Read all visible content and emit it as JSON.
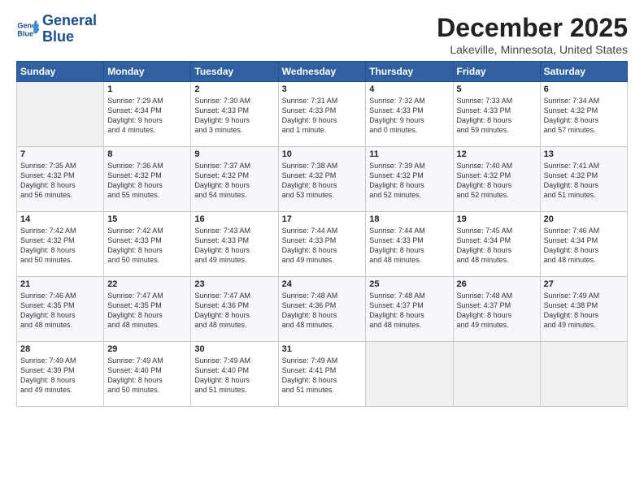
{
  "logo": {
    "line1": "General",
    "line2": "Blue"
  },
  "title": "December 2025",
  "location": "Lakeville, Minnesota, United States",
  "days_of_week": [
    "Sunday",
    "Monday",
    "Tuesday",
    "Wednesday",
    "Thursday",
    "Friday",
    "Saturday"
  ],
  "weeks": [
    [
      {
        "day": "",
        "info": ""
      },
      {
        "day": "1",
        "info": "Sunrise: 7:29 AM\nSunset: 4:34 PM\nDaylight: 9 hours\nand 4 minutes."
      },
      {
        "day": "2",
        "info": "Sunrise: 7:30 AM\nSunset: 4:33 PM\nDaylight: 9 hours\nand 3 minutes."
      },
      {
        "day": "3",
        "info": "Sunrise: 7:31 AM\nSunset: 4:33 PM\nDaylight: 9 hours\nand 1 minute."
      },
      {
        "day": "4",
        "info": "Sunrise: 7:32 AM\nSunset: 4:33 PM\nDaylight: 9 hours\nand 0 minutes."
      },
      {
        "day": "5",
        "info": "Sunrise: 7:33 AM\nSunset: 4:33 PM\nDaylight: 8 hours\nand 59 minutes."
      },
      {
        "day": "6",
        "info": "Sunrise: 7:34 AM\nSunset: 4:32 PM\nDaylight: 8 hours\nand 57 minutes."
      }
    ],
    [
      {
        "day": "7",
        "info": "Sunrise: 7:35 AM\nSunset: 4:32 PM\nDaylight: 8 hours\nand 56 minutes."
      },
      {
        "day": "8",
        "info": "Sunrise: 7:36 AM\nSunset: 4:32 PM\nDaylight: 8 hours\nand 55 minutes."
      },
      {
        "day": "9",
        "info": "Sunrise: 7:37 AM\nSunset: 4:32 PM\nDaylight: 8 hours\nand 54 minutes."
      },
      {
        "day": "10",
        "info": "Sunrise: 7:38 AM\nSunset: 4:32 PM\nDaylight: 8 hours\nand 53 minutes."
      },
      {
        "day": "11",
        "info": "Sunrise: 7:39 AM\nSunset: 4:32 PM\nDaylight: 8 hours\nand 52 minutes."
      },
      {
        "day": "12",
        "info": "Sunrise: 7:40 AM\nSunset: 4:32 PM\nDaylight: 8 hours\nand 52 minutes."
      },
      {
        "day": "13",
        "info": "Sunrise: 7:41 AM\nSunset: 4:32 PM\nDaylight: 8 hours\nand 51 minutes."
      }
    ],
    [
      {
        "day": "14",
        "info": "Sunrise: 7:42 AM\nSunset: 4:32 PM\nDaylight: 8 hours\nand 50 minutes."
      },
      {
        "day": "15",
        "info": "Sunrise: 7:42 AM\nSunset: 4:33 PM\nDaylight: 8 hours\nand 50 minutes."
      },
      {
        "day": "16",
        "info": "Sunrise: 7:43 AM\nSunset: 4:33 PM\nDaylight: 8 hours\nand 49 minutes."
      },
      {
        "day": "17",
        "info": "Sunrise: 7:44 AM\nSunset: 4:33 PM\nDaylight: 8 hours\nand 49 minutes."
      },
      {
        "day": "18",
        "info": "Sunrise: 7:44 AM\nSunset: 4:33 PM\nDaylight: 8 hours\nand 48 minutes."
      },
      {
        "day": "19",
        "info": "Sunrise: 7:45 AM\nSunset: 4:34 PM\nDaylight: 8 hours\nand 48 minutes."
      },
      {
        "day": "20",
        "info": "Sunrise: 7:46 AM\nSunset: 4:34 PM\nDaylight: 8 hours\nand 48 minutes."
      }
    ],
    [
      {
        "day": "21",
        "info": "Sunrise: 7:46 AM\nSunset: 4:35 PM\nDaylight: 8 hours\nand 48 minutes."
      },
      {
        "day": "22",
        "info": "Sunrise: 7:47 AM\nSunset: 4:35 PM\nDaylight: 8 hours\nand 48 minutes."
      },
      {
        "day": "23",
        "info": "Sunrise: 7:47 AM\nSunset: 4:36 PM\nDaylight: 8 hours\nand 48 minutes."
      },
      {
        "day": "24",
        "info": "Sunrise: 7:48 AM\nSunset: 4:36 PM\nDaylight: 8 hours\nand 48 minutes."
      },
      {
        "day": "25",
        "info": "Sunrise: 7:48 AM\nSunset: 4:37 PM\nDaylight: 8 hours\nand 48 minutes."
      },
      {
        "day": "26",
        "info": "Sunrise: 7:48 AM\nSunset: 4:37 PM\nDaylight: 8 hours\nand 49 minutes."
      },
      {
        "day": "27",
        "info": "Sunrise: 7:49 AM\nSunset: 4:38 PM\nDaylight: 8 hours\nand 49 minutes."
      }
    ],
    [
      {
        "day": "28",
        "info": "Sunrise: 7:49 AM\nSunset: 4:39 PM\nDaylight: 8 hours\nand 49 minutes."
      },
      {
        "day": "29",
        "info": "Sunrise: 7:49 AM\nSunset: 4:40 PM\nDaylight: 8 hours\nand 50 minutes."
      },
      {
        "day": "30",
        "info": "Sunrise: 7:49 AM\nSunset: 4:40 PM\nDaylight: 8 hours\nand 51 minutes."
      },
      {
        "day": "31",
        "info": "Sunrise: 7:49 AM\nSunset: 4:41 PM\nDaylight: 8 hours\nand 51 minutes."
      },
      {
        "day": "",
        "info": ""
      },
      {
        "day": "",
        "info": ""
      },
      {
        "day": "",
        "info": ""
      }
    ]
  ]
}
